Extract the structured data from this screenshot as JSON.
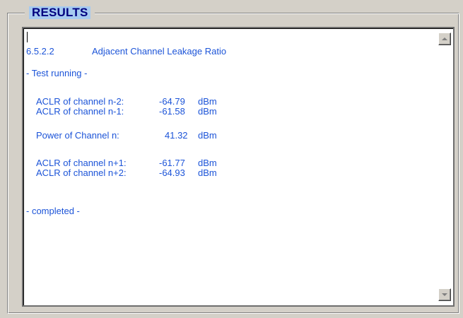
{
  "group": {
    "title": "RESULTS"
  },
  "results": {
    "section_number": "6.5.2.2",
    "section_title": "Adjacent Channel Leakage Ratio",
    "status_running": "- Test running -",
    "status_completed": "- completed -",
    "measurements": [
      {
        "label": "ACLR of channel n-2:",
        "value": "-64.79",
        "unit": "dBm"
      },
      {
        "label": "ACLR of channel n-1:",
        "value": "-61.58",
        "unit": "dBm"
      },
      {
        "label": "Power of Channel n:",
        "value": "41.32",
        "unit": "dBm"
      },
      {
        "label": "ACLR of channel n+1:",
        "value": "-61.77",
        "unit": "dBm"
      },
      {
        "label": "ACLR of channel n+2:",
        "value": "-64.93",
        "unit": "dBm"
      }
    ]
  },
  "scrollbar": {
    "up_icon": "triangle-up",
    "down_icon": "triangle-down"
  },
  "colors": {
    "text": "#1c54d8",
    "legend_bg": "#a6caf0",
    "legend_text": "#000080",
    "window_bg": "#d4d0c8"
  }
}
